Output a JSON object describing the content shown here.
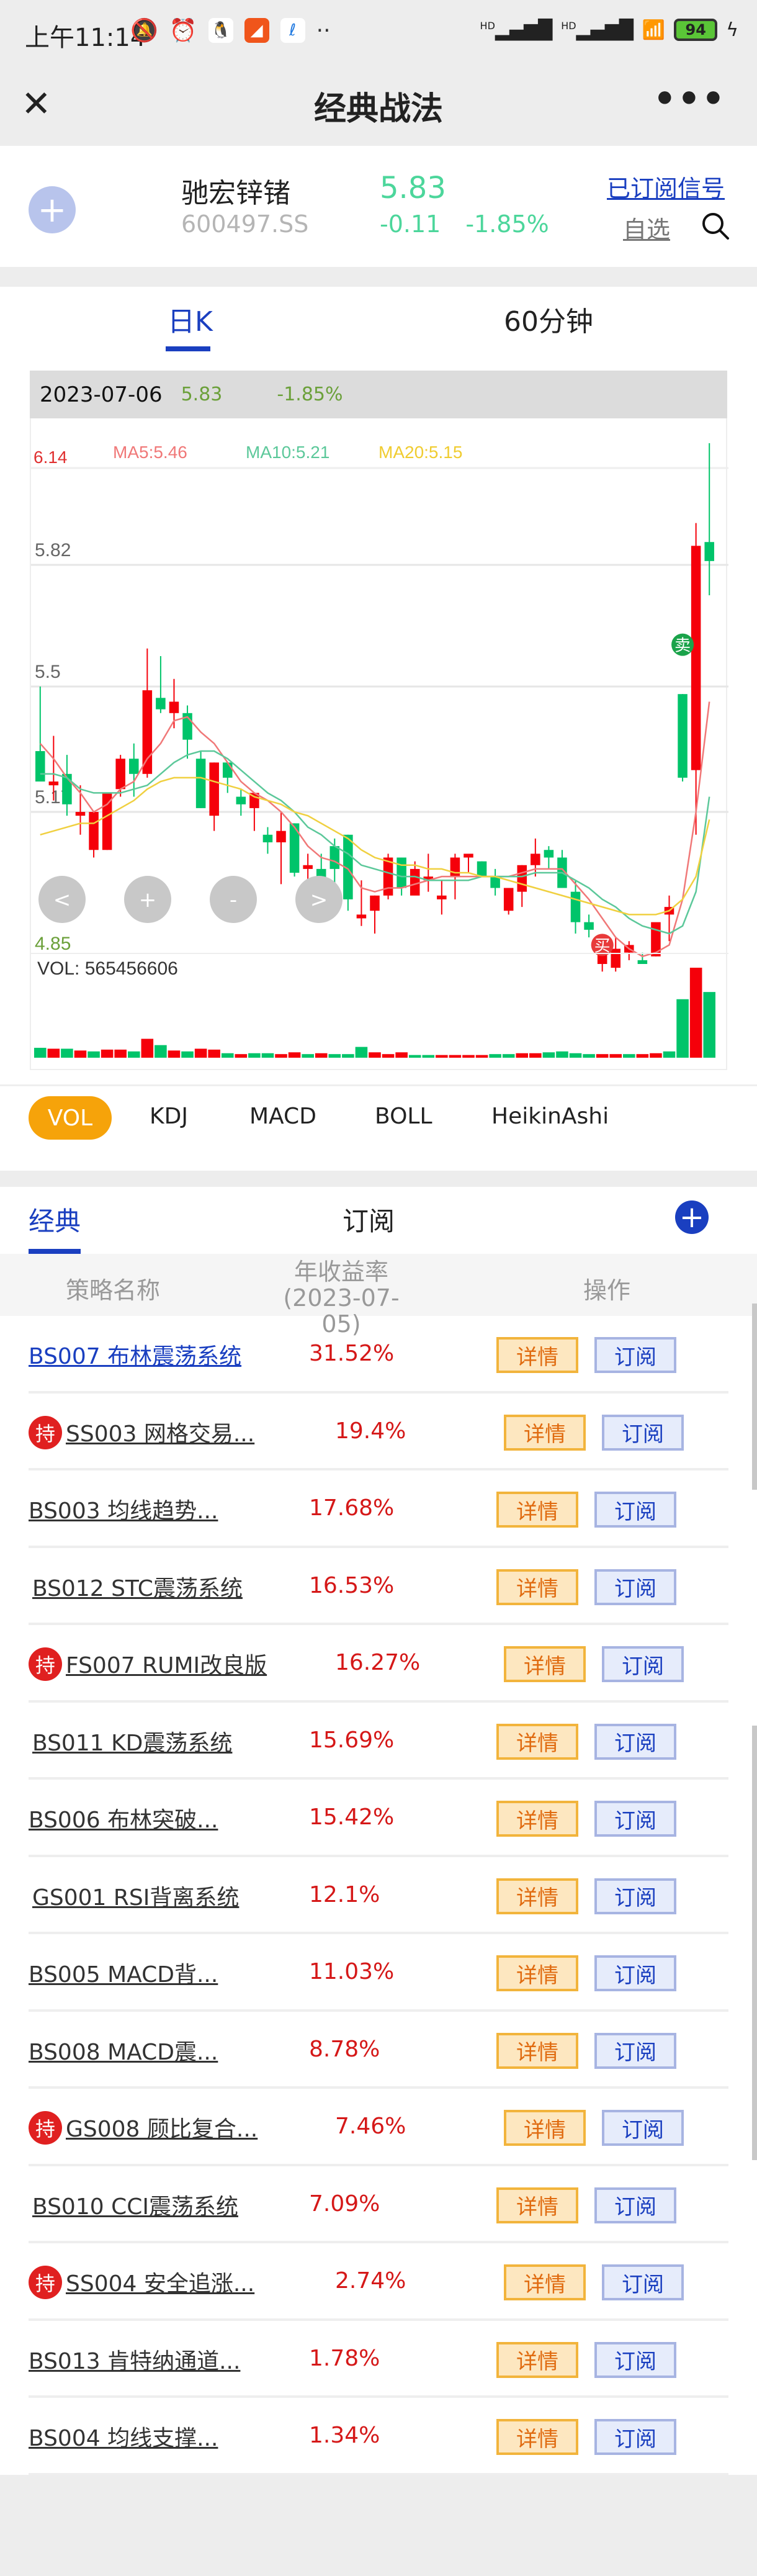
{
  "status_bar": {
    "time": "上午11:14",
    "icons": [
      "mute-icon",
      "alarm-icon",
      "qq-icon",
      "app-icon",
      "telecom-icon"
    ],
    "more_dots": "··",
    "signal1": "HD",
    "signal2": "HD",
    "battery": "94"
  },
  "nav": {
    "close_label": "✕",
    "title": "经典战法",
    "more_label": "•••"
  },
  "stock": {
    "add_label": "+",
    "name": "驰宏锌锗",
    "code": "600497.SS",
    "price": "5.83",
    "change": "-0.11",
    "change_pct": "-1.85%",
    "subscribed_link": "已订阅信号",
    "watchlist_link": "自选",
    "price_color": "#4cd69b"
  },
  "chart_tabs": {
    "day": "日K",
    "min60": "60分钟"
  },
  "info_bar": {
    "date": "2023-07-06",
    "price": "5.83",
    "change_pct": "-1.85%"
  },
  "ma_legend": {
    "top_price": "6.14",
    "ma5": "MA5:5.46",
    "ma10": "MA10:5.21",
    "ma20": "MA20:5.15",
    "bottom_price": "4.85",
    "vol_label": "VOL: 565456606"
  },
  "chart_controls": {
    "prev": "<",
    "zoom_in": "+",
    "zoom_out": "-",
    "next": ">"
  },
  "chart_data": {
    "type": "candlestick",
    "title": "驰宏锌锗 600497.SS 日K",
    "ylim": [
      4.85,
      6.14
    ],
    "y_ticks": [
      5.17,
      5.5,
      5.82
    ],
    "colors": {
      "up": "#f5000a",
      "down": "#00c46a",
      "ma5": "#f07878",
      "ma10": "#5cc89a",
      "ma20": "#f0d040"
    },
    "candles": [
      [
        5.33,
        5.5,
        5.25,
        5.25
      ],
      [
        5.24,
        5.37,
        5.2,
        5.25
      ],
      [
        5.27,
        5.32,
        5.16,
        5.19
      ],
      [
        5.16,
        5.24,
        5.11,
        5.17
      ],
      [
        5.07,
        5.17,
        5.05,
        5.17
      ],
      [
        5.07,
        5.22,
        5.07,
        5.22
      ],
      [
        5.23,
        5.32,
        5.21,
        5.31
      ],
      [
        5.31,
        5.35,
        5.21,
        5.27
      ],
      [
        5.27,
        5.6,
        5.26,
        5.49
      ],
      [
        5.47,
        5.58,
        5.43,
        5.44
      ],
      [
        5.43,
        5.52,
        5.39,
        5.46
      ],
      [
        5.43,
        5.45,
        5.31,
        5.36
      ],
      [
        5.31,
        5.33,
        5.18,
        5.18
      ],
      [
        5.16,
        5.3,
        5.12,
        5.3
      ],
      [
        5.3,
        5.3,
        5.22,
        5.26
      ],
      [
        5.21,
        5.23,
        5.16,
        5.19
      ],
      [
        5.18,
        5.22,
        5.12,
        5.22
      ],
      [
        5.11,
        5.13,
        5.06,
        5.09
      ],
      [
        5.09,
        5.17,
        4.98,
        5.12
      ],
      [
        5.14,
        5.14,
        5.0,
        5.01
      ],
      [
        5.02,
        5.06,
        4.95,
        5.03
      ],
      [
        5.02,
        5.06,
        4.95,
        4.99
      ],
      [
        5.08,
        5.1,
        4.93,
        5.02
      ],
      [
        5.11,
        5.11,
        4.91,
        4.94
      ],
      [
        4.89,
        4.99,
        4.87,
        4.9
      ],
      [
        4.91,
        4.95,
        4.85,
        4.95
      ],
      [
        4.95,
        5.06,
        4.94,
        5.05
      ],
      [
        5.05,
        5.05,
        4.95,
        4.97
      ],
      [
        4.95,
        5.04,
        4.96,
        5.02
      ],
      [
        4.99,
        5.06,
        4.96,
        5.0
      ],
      [
        4.94,
        4.99,
        4.9,
        4.95
      ],
      [
        5.0,
        5.06,
        4.94,
        5.05
      ],
      [
        5.05,
        5.05,
        5.01,
        5.06
      ],
      [
        5.04,
        5.04,
        5.0,
        5.0
      ],
      [
        5.0,
        5.02,
        4.95,
        4.97
      ],
      [
        4.91,
        4.97,
        4.9,
        4.97
      ],
      [
        4.96,
        5.03,
        4.92,
        5.03
      ],
      [
        5.03,
        5.1,
        5.0,
        5.06
      ],
      [
        5.07,
        5.08,
        5.02,
        5.05
      ],
      [
        5.05,
        5.07,
        4.97,
        4.97
      ],
      [
        4.96,
        4.99,
        4.85,
        4.88
      ],
      [
        4.88,
        4.9,
        4.84,
        4.86
      ],
      [
        4.77,
        4.84,
        4.75,
        4.8
      ],
      [
        4.76,
        4.84,
        4.75,
        4.81
      ],
      [
        4.8,
        4.83,
        4.78,
        4.82
      ],
      [
        4.78,
        4.8,
        4.77,
        4.77
      ],
      [
        4.79,
        4.87,
        4.79,
        4.88
      ],
      [
        4.9,
        4.95,
        4.83,
        4.92
      ],
      [
        5.48,
        5.48,
        5.25,
        5.26
      ],
      [
        5.28,
        5.93,
        5.11,
        5.87
      ],
      [
        5.88,
        6.14,
        5.74,
        5.83
      ]
    ],
    "ma5": [
      5.35,
      5.31,
      5.26,
      5.22,
      5.17,
      5.19,
      5.23,
      5.25,
      5.31,
      5.35,
      5.41,
      5.42,
      5.38,
      5.35,
      5.3,
      5.25,
      5.22,
      5.2,
      5.17,
      5.13,
      5.08,
      5.05,
      5.04,
      5.02,
      4.97,
      4.96,
      4.97,
      4.97,
      4.98,
      4.99,
      5.0,
      5.0,
      5.0,
      5.0,
      5.0,
      5.0,
      5.01,
      5.02,
      5.02,
      5.02,
      4.98,
      4.94,
      4.89,
      4.84,
      4.81,
      4.79,
      4.8,
      4.82,
      4.94,
      5.17,
      5.46
    ],
    "ma10": [
      5.27,
      5.27,
      5.26,
      5.23,
      5.22,
      5.22,
      5.22,
      5.23,
      5.24,
      5.27,
      5.3,
      5.32,
      5.33,
      5.33,
      5.31,
      5.28,
      5.25,
      5.22,
      5.2,
      5.17,
      5.13,
      5.11,
      5.08,
      5.06,
      5.03,
      5.02,
      5.01,
      5.0,
      5.0,
      4.99,
      4.99,
      4.99,
      4.99,
      5.0,
      5.0,
      5.0,
      5.0,
      5.01,
      5.01,
      5.01,
      4.99,
      4.97,
      4.94,
      4.92,
      4.89,
      4.87,
      4.86,
      4.85,
      4.87,
      4.96,
      5.21
    ],
    "ma20": [
      5.11,
      5.12,
      5.13,
      5.14,
      5.14,
      5.16,
      5.18,
      5.2,
      5.23,
      5.25,
      5.26,
      5.26,
      5.26,
      5.25,
      5.24,
      5.23,
      5.21,
      5.2,
      5.19,
      5.17,
      5.16,
      5.14,
      5.12,
      5.1,
      5.07,
      5.05,
      5.04,
      5.03,
      5.03,
      5.02,
      5.02,
      5.01,
      5.01,
      5.0,
      5.0,
      4.99,
      4.98,
      4.97,
      4.96,
      4.95,
      4.94,
      4.93,
      4.92,
      4.91,
      4.9,
      4.9,
      4.9,
      4.91,
      4.94,
      5.0,
      5.15
    ],
    "signals": [
      {
        "label": "卖",
        "index": 48,
        "type": "sell"
      },
      {
        "label": "买",
        "index": 42,
        "type": "buy"
      }
    ],
    "volume_label": "VOL",
    "volume": [
      0.11,
      0.1,
      0.1,
      0.08,
      0.07,
      0.09,
      0.09,
      0.07,
      0.21,
      0.14,
      0.08,
      0.07,
      0.1,
      0.09,
      0.05,
      0.04,
      0.05,
      0.05,
      0.04,
      0.06,
      0.04,
      0.05,
      0.04,
      0.04,
      0.12,
      0.06,
      0.04,
      0.06,
      0.03,
      0.03,
      0.03,
      0.03,
      0.03,
      0.03,
      0.04,
      0.04,
      0.05,
      0.05,
      0.06,
      0.07,
      0.05,
      0.04,
      0.04,
      0.04,
      0.04,
      0.04,
      0.05,
      0.07,
      0.65,
      1.0,
      0.73
    ],
    "volume_up": [
      false,
      true,
      false,
      true,
      false,
      true,
      true,
      false,
      true,
      false,
      true,
      false,
      true,
      true,
      false,
      true,
      false,
      false,
      true,
      true,
      false,
      true,
      false,
      false,
      false,
      true,
      true,
      true,
      false,
      false,
      true,
      true,
      true,
      true,
      false,
      false,
      true,
      true,
      false,
      false,
      false,
      false,
      true,
      true,
      false,
      true,
      true,
      false,
      false,
      true,
      false
    ]
  },
  "indicator_tabs": [
    "VOL",
    "KDJ",
    "MACD",
    "BOLL",
    "HeikinAshi"
  ],
  "strategy_tabs": {
    "classic": "经典",
    "subscribe": "订阅",
    "add": "+"
  },
  "table_header": {
    "name": "策略名称",
    "rate_line1": "年收益率",
    "rate_line2": "(2023-07-05)",
    "action": "操作"
  },
  "buttons": {
    "detail": "详情",
    "subscribe": "订阅"
  },
  "hold_badge": "持",
  "strategies": [
    {
      "name": "BS007 布林震荡系统",
      "rate": "31.52%",
      "held": false
    },
    {
      "name": "SS003 网格交易...",
      "rate": "19.4%",
      "held": true
    },
    {
      "name": "BS003 均线趋势...",
      "rate": "17.68%",
      "held": false
    },
    {
      "name": "BS012 STC震荡系统",
      "rate": "16.53%",
      "held": false
    },
    {
      "name": "FS007 RUMI改良版",
      "rate": "16.27%",
      "held": true
    },
    {
      "name": "BS011 KD震荡系统",
      "rate": "15.69%",
      "held": false
    },
    {
      "name": "BS006 布林突破...",
      "rate": "15.42%",
      "held": false
    },
    {
      "name": "GS001 RSI背离系统",
      "rate": "12.1%",
      "held": false
    },
    {
      "name": "BS005 MACD背...",
      "rate": "11.03%",
      "held": false
    },
    {
      "name": "BS008 MACD震...",
      "rate": "8.78%",
      "held": false
    },
    {
      "name": "GS008 顾比复合...",
      "rate": "7.46%",
      "held": true
    },
    {
      "name": "BS010 CCI震荡系统",
      "rate": "7.09%",
      "held": false
    },
    {
      "name": "SS004 安全追涨...",
      "rate": "2.74%",
      "held": true
    },
    {
      "name": "BS013 肯特纳通道...",
      "rate": "1.78%",
      "held": false
    },
    {
      "name": "BS004 均线支撑...",
      "rate": "1.34%",
      "held": false
    }
  ]
}
